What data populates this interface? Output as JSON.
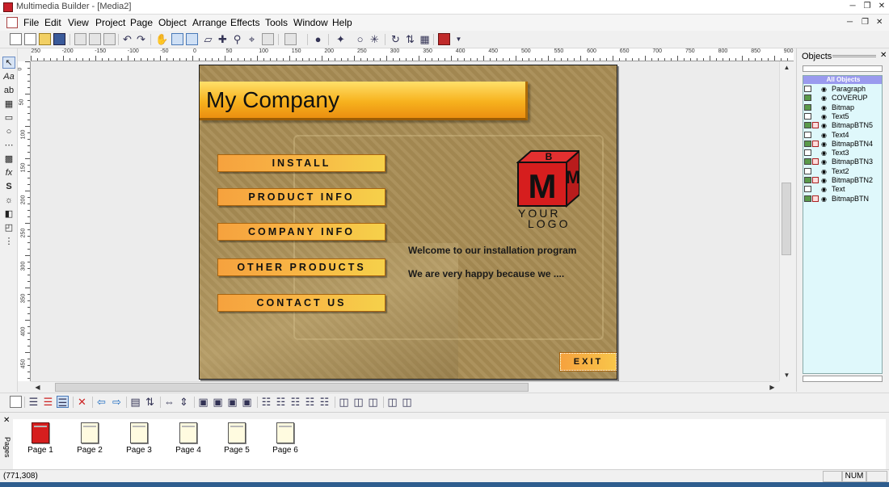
{
  "window": {
    "title": "Multimedia Builder - [Media2]"
  },
  "menubar": {
    "items": [
      "File",
      "Edit",
      "View",
      "Project",
      "Page",
      "Object",
      "Arrange",
      "Effects",
      "Tools",
      "Window",
      "Help"
    ]
  },
  "rulers": {
    "h_labels": [
      "-250",
      "-200",
      "-150",
      "-100",
      "-50",
      "0",
      "50",
      "100",
      "150",
      "200",
      "250",
      "300",
      "350",
      "400",
      "450",
      "500",
      "550",
      "600",
      "650",
      "700",
      "750",
      "800",
      "850",
      "900"
    ],
    "v_labels": [
      "0",
      "50",
      "100",
      "150",
      "200",
      "250",
      "300",
      "350",
      "400",
      "450"
    ]
  },
  "canvas": {
    "banner_text": "My Company",
    "buttons": [
      "INSTALL",
      "PRODUCT INFO",
      "COMPANY INFO",
      "OTHER PRODUCTS",
      "CONTACT US"
    ],
    "logo": {
      "cube_letters": [
        "B",
        "M",
        "M"
      ],
      "line1": "YOUR",
      "line2": "LOGO"
    },
    "welcome_line1": "Welcome to our installation program",
    "welcome_line2": "We are very happy because we ....",
    "exit_label": "EXIT",
    "colors": {
      "background": "#a88c54",
      "button_orange": "#f6a23e",
      "button_yellow": "#f6d14a",
      "banner_yellow": "#ffe06a",
      "logo_red": "#d61e1e"
    }
  },
  "objects_panel": {
    "title": "Objects",
    "header": "All Objects",
    "items": [
      {
        "name": "Paragraph",
        "kind": "text"
      },
      {
        "name": "COVERUP",
        "kind": "bitmap"
      },
      {
        "name": "Bitmap",
        "kind": "bitmap"
      },
      {
        "name": "Text5",
        "kind": "text"
      },
      {
        "name": "BitmapBTN5",
        "kind": "button"
      },
      {
        "name": "Text4",
        "kind": "text"
      },
      {
        "name": "BitmapBTN4",
        "kind": "button"
      },
      {
        "name": "Text3",
        "kind": "text"
      },
      {
        "name": "BitmapBTN3",
        "kind": "button"
      },
      {
        "name": "Text2",
        "kind": "text"
      },
      {
        "name": "BitmapBTN2",
        "kind": "button"
      },
      {
        "name": "Text",
        "kind": "text"
      },
      {
        "name": "BitmapBTN",
        "kind": "button"
      }
    ]
  },
  "pages_panel": {
    "label": "Pages",
    "pages": [
      "Page 1",
      "Page 2",
      "Page 3",
      "Page 4",
      "Page 5",
      "Page 6"
    ],
    "active_page": "Page 1"
  },
  "statusbar": {
    "coords": "(771,308)",
    "num": "NUM"
  }
}
